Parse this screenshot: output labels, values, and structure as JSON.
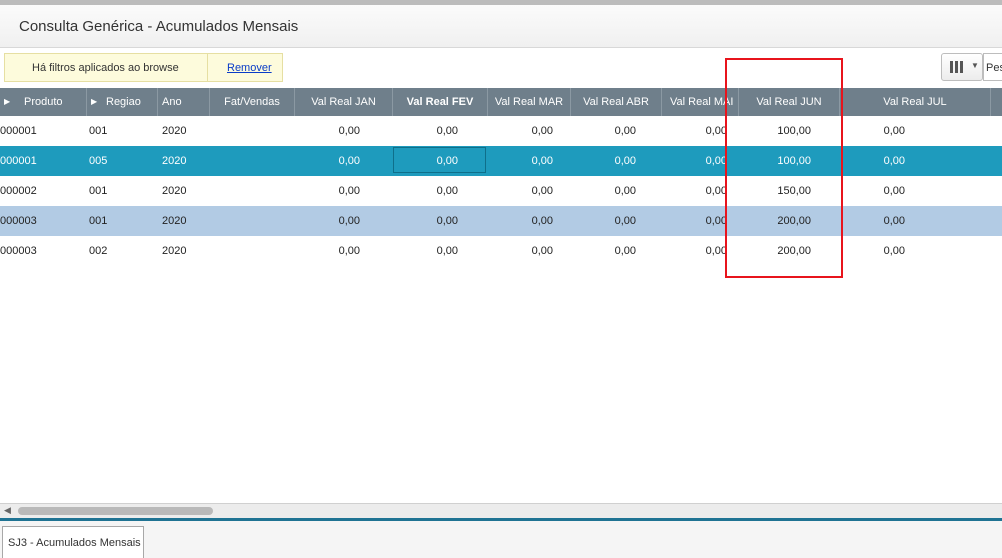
{
  "window": {
    "title": "Consulta Genérica - Acumulados Mensais"
  },
  "filter": {
    "message": "Há filtros aplicados ao browse",
    "remove_label": "Remover"
  },
  "toolbar": {
    "search_placeholder": "Pes"
  },
  "table": {
    "columns": [
      "Produto",
      "Regiao",
      "Ano",
      "Fat/Vendas",
      "Val Real JAN",
      "Val Real FEV",
      "Val Real MAR",
      "Val Real ABR",
      "Val Real MAI",
      "Val Real JUN",
      "Val Real JUL"
    ],
    "rows": [
      [
        "000001",
        "001",
        "2020",
        "",
        "0,00",
        "0,00",
        "0,00",
        "0,00",
        "0,00",
        "100,00",
        "0,00"
      ],
      [
        "000001",
        "005",
        "2020",
        "",
        "0,00",
        "0,00",
        "0,00",
        "0,00",
        "0,00",
        "100,00",
        "0,00"
      ],
      [
        "000002",
        "001",
        "2020",
        "",
        "0,00",
        "0,00",
        "0,00",
        "0,00",
        "0,00",
        "150,00",
        "0,00"
      ],
      [
        "000003",
        "001",
        "2020",
        "",
        "0,00",
        "0,00",
        "0,00",
        "0,00",
        "0,00",
        "200,00",
        "0,00"
      ],
      [
        "000003",
        "002",
        "2020",
        "",
        "0,00",
        "0,00",
        "0,00",
        "0,00",
        "0,00",
        "200,00",
        "0,00"
      ]
    ]
  },
  "tabs": [
    {
      "label": "SJ3 - Acumulados Mensais"
    }
  ]
}
